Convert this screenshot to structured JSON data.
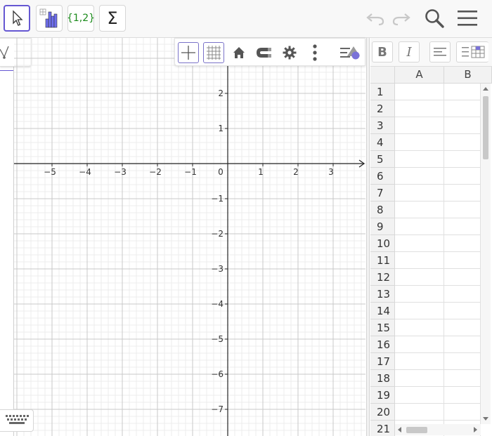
{
  "toolbar": {
    "tools": [
      {
        "name": "move-tool",
        "icon": "pointer-arrow-icon",
        "active": true
      },
      {
        "name": "spreadsheet-chart-tool",
        "icon": "bar-chart-icon"
      },
      {
        "name": "list-tool",
        "icon": "curly-set-icon",
        "label": "{1,2}"
      },
      {
        "name": "sum-tool",
        "icon": "sigma-icon",
        "label": "Σ"
      }
    ],
    "right": [
      "undo-icon",
      "redo-icon",
      "search-icon",
      "menu-icon"
    ]
  },
  "style_bar": {
    "buttons": [
      "axes-icon",
      "grid-icon",
      "home-icon",
      "magnet-icon",
      "gear-icon",
      "more-vertical-icon",
      "toggle-style-bar-icon"
    ]
  },
  "graphics": {
    "x_tick_labels": [
      "−5",
      "−4",
      "−3",
      "−2",
      "−1",
      "0",
      "1",
      "2",
      "3"
    ],
    "y_tick_labels": [
      "2",
      "1",
      "−1",
      "−2",
      "−3",
      "−4",
      "−5",
      "−6",
      "−7"
    ],
    "x_ticks": [
      -5,
      -4,
      -3,
      -2,
      -1,
      0,
      1,
      2,
      3
    ],
    "y_ticks": [
      2,
      1,
      -1,
      -2,
      -3,
      -4,
      -5,
      -6,
      -7
    ],
    "axis_color": "#222222",
    "major_grid_color": "#c9c9c9",
    "minor_grid_color": "#ececec"
  },
  "spreadsheet": {
    "format_buttons": {
      "bold": "B",
      "italic": "I"
    },
    "columns": [
      "A",
      "B"
    ],
    "rows": [
      "1",
      "2",
      "3",
      "4",
      "5",
      "6",
      "7",
      "8",
      "9",
      "10",
      "11",
      "12",
      "13",
      "14",
      "15",
      "16",
      "17",
      "18",
      "19",
      "20",
      "21"
    ]
  }
}
